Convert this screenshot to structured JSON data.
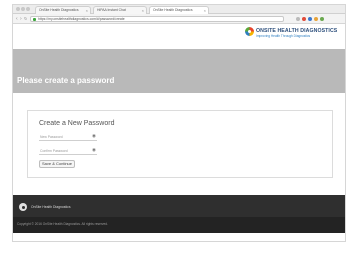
{
  "browser": {
    "tabs": [
      {
        "label": "OnSite Health Diagnostics"
      },
      {
        "label": "HiPAA Instant Chat"
      },
      {
        "label": "OnSite Health Diagnostics"
      }
    ],
    "url": "https://my.onsitehealthdiagnostics.com/#/password/create",
    "back_icon": "back-arrow-icon",
    "forward_icon": "forward-arrow-icon",
    "reload_icon": "reload-icon"
  },
  "header": {
    "brand_name": "ONSITE HEALTH DIAGNOSTICS",
    "brand_tagline": "Improving Health Through Diagnostics"
  },
  "banner": {
    "title": "Please create a password"
  },
  "form": {
    "title": "Create a New Password",
    "new_password_placeholder": "New Password",
    "confirm_password_placeholder": "Confirm Password",
    "submit_label": "Save & Continue"
  },
  "footer": {
    "brand": "OnSite Health Diagnostics",
    "copyright": "Copyright © 2016 OnSite Health Diagnostics. All rights reserved."
  },
  "colors": {
    "banner_bg": "#b9b9b9",
    "footer_bg": "#2f2f2f",
    "brand_blue": "#2d4f7c"
  }
}
